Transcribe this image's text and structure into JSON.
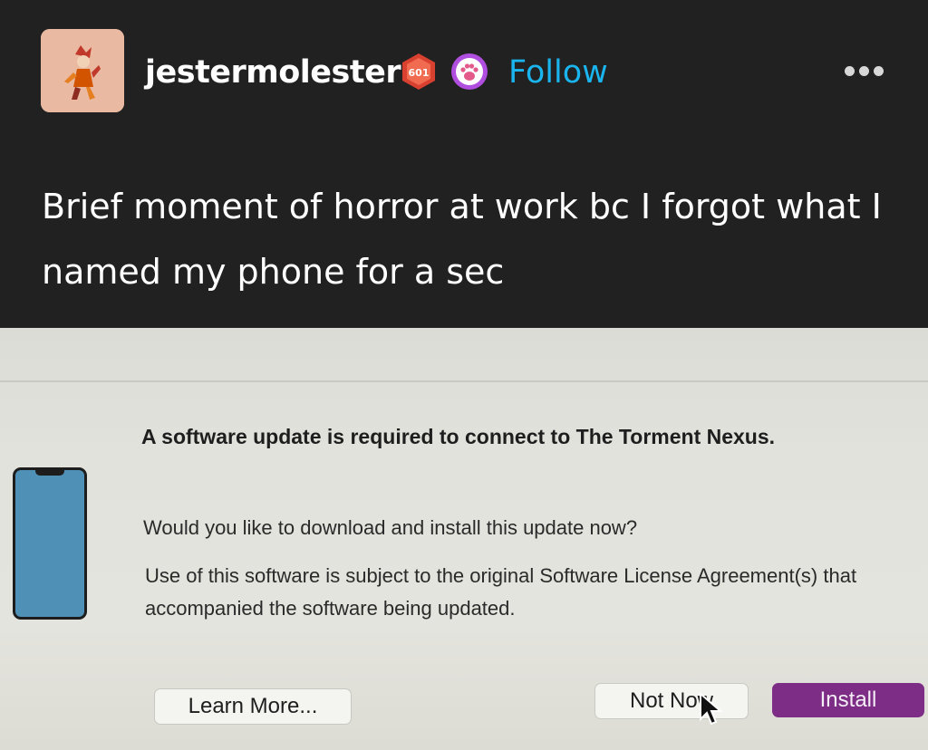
{
  "post": {
    "username": "jestermolester",
    "badge_level": "601",
    "follow_label": "Follow",
    "body": "Brief moment of horror at work bc I forgot what I named my phone for a sec"
  },
  "dialog": {
    "title": "A software update is required to connect to The Torment Nexus.",
    "question": "Would you like to download and install this update now?",
    "license": "Use of this software is subject to the original Software License Agreement(s) that accompanied the software being updated.",
    "learn_more_label": "Learn More...",
    "not_now_label": "Not Now",
    "install_label": "Install"
  },
  "colors": {
    "background": "#212121",
    "follow": "#1ab4ee",
    "install_button": "#7d2d86",
    "phone_screen": "#4f90b6",
    "badge_red": "#d8402f",
    "badge_purple": "#b04ee0"
  },
  "icons": [
    "avatar-jester",
    "level-badge-icon",
    "paw-badge-icon",
    "more-options-icon",
    "phone-icon",
    "mouse-cursor-icon"
  ]
}
